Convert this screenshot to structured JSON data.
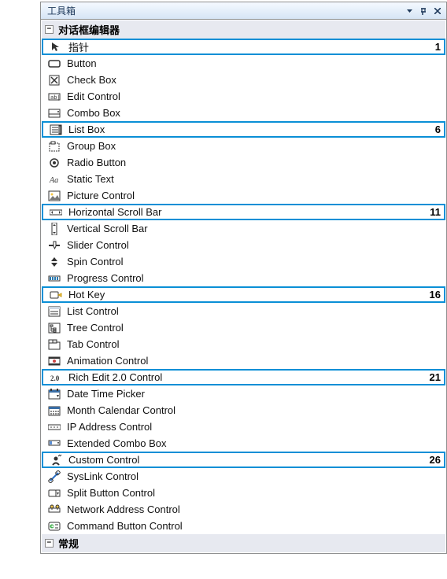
{
  "title": "工具箱",
  "sections": {
    "dialog_editor": {
      "label": "对话框编辑器"
    },
    "general": {
      "label": "常规"
    }
  },
  "items": [
    {
      "icon": "pointer-icon",
      "label": "指针",
      "highlighted": true,
      "num": "1"
    },
    {
      "icon": "button-icon",
      "label": "Button"
    },
    {
      "icon": "checkbox-icon",
      "label": "Check Box"
    },
    {
      "icon": "edit-icon",
      "label": "Edit Control"
    },
    {
      "icon": "combobox-icon",
      "label": "Combo Box"
    },
    {
      "icon": "listbox-icon",
      "label": "List Box",
      "highlighted": true,
      "num": "6"
    },
    {
      "icon": "groupbox-icon",
      "label": "Group Box"
    },
    {
      "icon": "radio-icon",
      "label": "Radio Button"
    },
    {
      "icon": "statictext-icon",
      "label": "Static Text"
    },
    {
      "icon": "picture-icon",
      "label": "Picture Control"
    },
    {
      "icon": "hscroll-icon",
      "label": "Horizontal Scroll Bar",
      "highlighted": true,
      "num": "11"
    },
    {
      "icon": "vscroll-icon",
      "label": "Vertical Scroll Bar"
    },
    {
      "icon": "slider-icon",
      "label": "Slider Control"
    },
    {
      "icon": "spin-icon",
      "label": "Spin Control"
    },
    {
      "icon": "progress-icon",
      "label": "Progress Control"
    },
    {
      "icon": "hotkey-icon",
      "label": "Hot Key",
      "highlighted": true,
      "num": "16"
    },
    {
      "icon": "listctrl-icon",
      "label": "List Control"
    },
    {
      "icon": "tree-icon",
      "label": "Tree Control"
    },
    {
      "icon": "tab-icon",
      "label": "Tab Control"
    },
    {
      "icon": "animation-icon",
      "label": "Animation Control"
    },
    {
      "icon": "richedit-icon",
      "label": "Rich Edit 2.0 Control",
      "highlighted": true,
      "num": "21"
    },
    {
      "icon": "datetime-icon",
      "label": "Date Time Picker"
    },
    {
      "icon": "month-icon",
      "label": "Month Calendar Control"
    },
    {
      "icon": "ip-icon",
      "label": "IP Address Control"
    },
    {
      "icon": "extcombo-icon",
      "label": "Extended Combo Box"
    },
    {
      "icon": "custom-icon",
      "label": "Custom Control",
      "highlighted": true,
      "num": "26"
    },
    {
      "icon": "syslink-icon",
      "label": "SysLink Control"
    },
    {
      "icon": "splitbutton-icon",
      "label": "Split Button Control"
    },
    {
      "icon": "netaddr-icon",
      "label": "Network Address Control"
    },
    {
      "icon": "cmdbutton-icon",
      "label": "Command Button Control"
    }
  ]
}
